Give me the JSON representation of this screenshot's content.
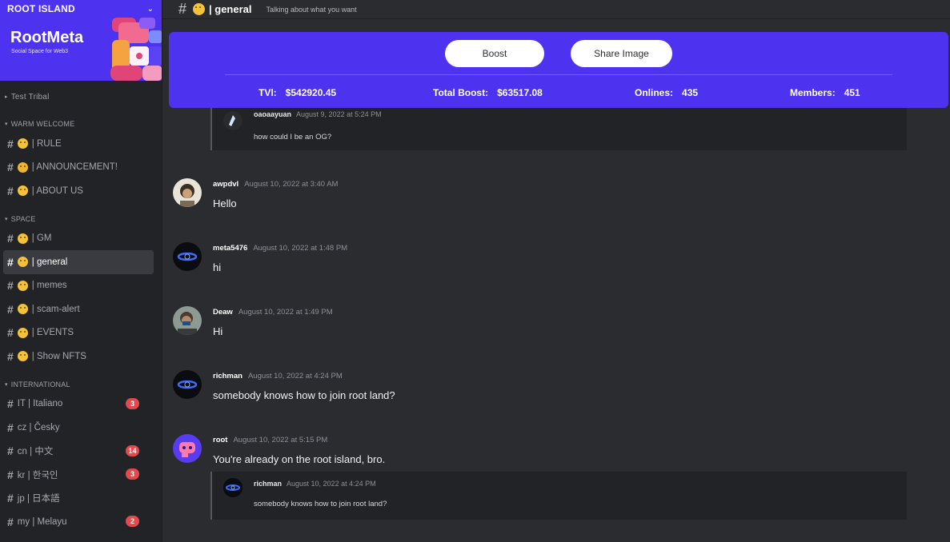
{
  "server": {
    "name": "ROOT ISLAND",
    "brand": "RootMeta",
    "tagline": "Social Space for Web3"
  },
  "sidebar": {
    "top_item": "Test Tribal",
    "sections": [
      {
        "title": "WARM WELCOME",
        "channels": [
          {
            "name": "| RULE",
            "icon": "smiley-emoji-icon"
          },
          {
            "name": "| ANNOUNCEMENT!",
            "icon": "crown-emoji-icon"
          },
          {
            "name": "| ABOUT US",
            "icon": "smiley-emoji-icon"
          }
        ]
      },
      {
        "title": "SPACE",
        "channels": [
          {
            "name": "| GM",
            "icon": "smiley-emoji-icon"
          },
          {
            "name": "| general",
            "icon": "smiley-emoji-icon",
            "active": true
          },
          {
            "name": "| memes",
            "icon": "laugh-emoji-icon"
          },
          {
            "name": "| scam-alert",
            "icon": "wink-emoji-icon"
          },
          {
            "name": "| EVENTS",
            "icon": "wink-emoji-icon"
          },
          {
            "name": "| Show NFTS",
            "icon": "star-eyes-emoji-icon"
          }
        ]
      },
      {
        "title": "INTERNATIONAL",
        "channels": [
          {
            "name": "IT | Italiano",
            "badge": "3"
          },
          {
            "name": "cz | Česky",
            "badge": ""
          },
          {
            "name": "cn | 中文",
            "badge": "14"
          },
          {
            "name": "kr | 한국인",
            "badge": "3"
          },
          {
            "name": "jp | 日本語",
            "badge": ""
          },
          {
            "name": "my | Melayu",
            "badge": "2"
          }
        ]
      }
    ]
  },
  "channel": {
    "hash": "#",
    "title": "| general",
    "topic": "Talking about what you want"
  },
  "stats": {
    "boost_label": "Boost",
    "share_label": "Share Image",
    "tvl_label": "TVl:",
    "tvl_value": "$542920.45",
    "total_boost_label": "Total Boost:",
    "total_boost_value": "$63517.08",
    "onlines_label": "Onlines:",
    "onlines_value": "435",
    "members_label": "Members:",
    "members_value": "451"
  },
  "messages": {
    "top_quote": {
      "user": "oaoaayuan",
      "time": "August 9, 2022 at 5:24 PM",
      "text": "how could I be an OG?"
    },
    "list": [
      {
        "user": "awpdvl",
        "time": "August 10, 2022 at 3:40 AM",
        "text": "Hello"
      },
      {
        "user": "meta5476",
        "time": "August 10, 2022 at 1:48 PM",
        "text": "hi"
      },
      {
        "user": "Deaw",
        "time": "August 10, 2022 at 1:49 PM",
        "text": "Hi"
      },
      {
        "user": "richman",
        "time": "August 10, 2022 at 4:24 PM",
        "text": "somebody knows how to join root land?"
      },
      {
        "user": "root",
        "time": "August 10, 2022 at 5:15 PM",
        "text": "You're already on the root island, bro."
      }
    ],
    "reply_quote": {
      "user": "richman",
      "time": "August 10, 2022 at 4:24 PM",
      "text": "somebody knows how to join root land?"
    }
  },
  "colors": {
    "accent": "#4d32f0",
    "sidebar_bg": "#222327",
    "main_bg": "#2b2c30",
    "badge": "#e5484d"
  }
}
